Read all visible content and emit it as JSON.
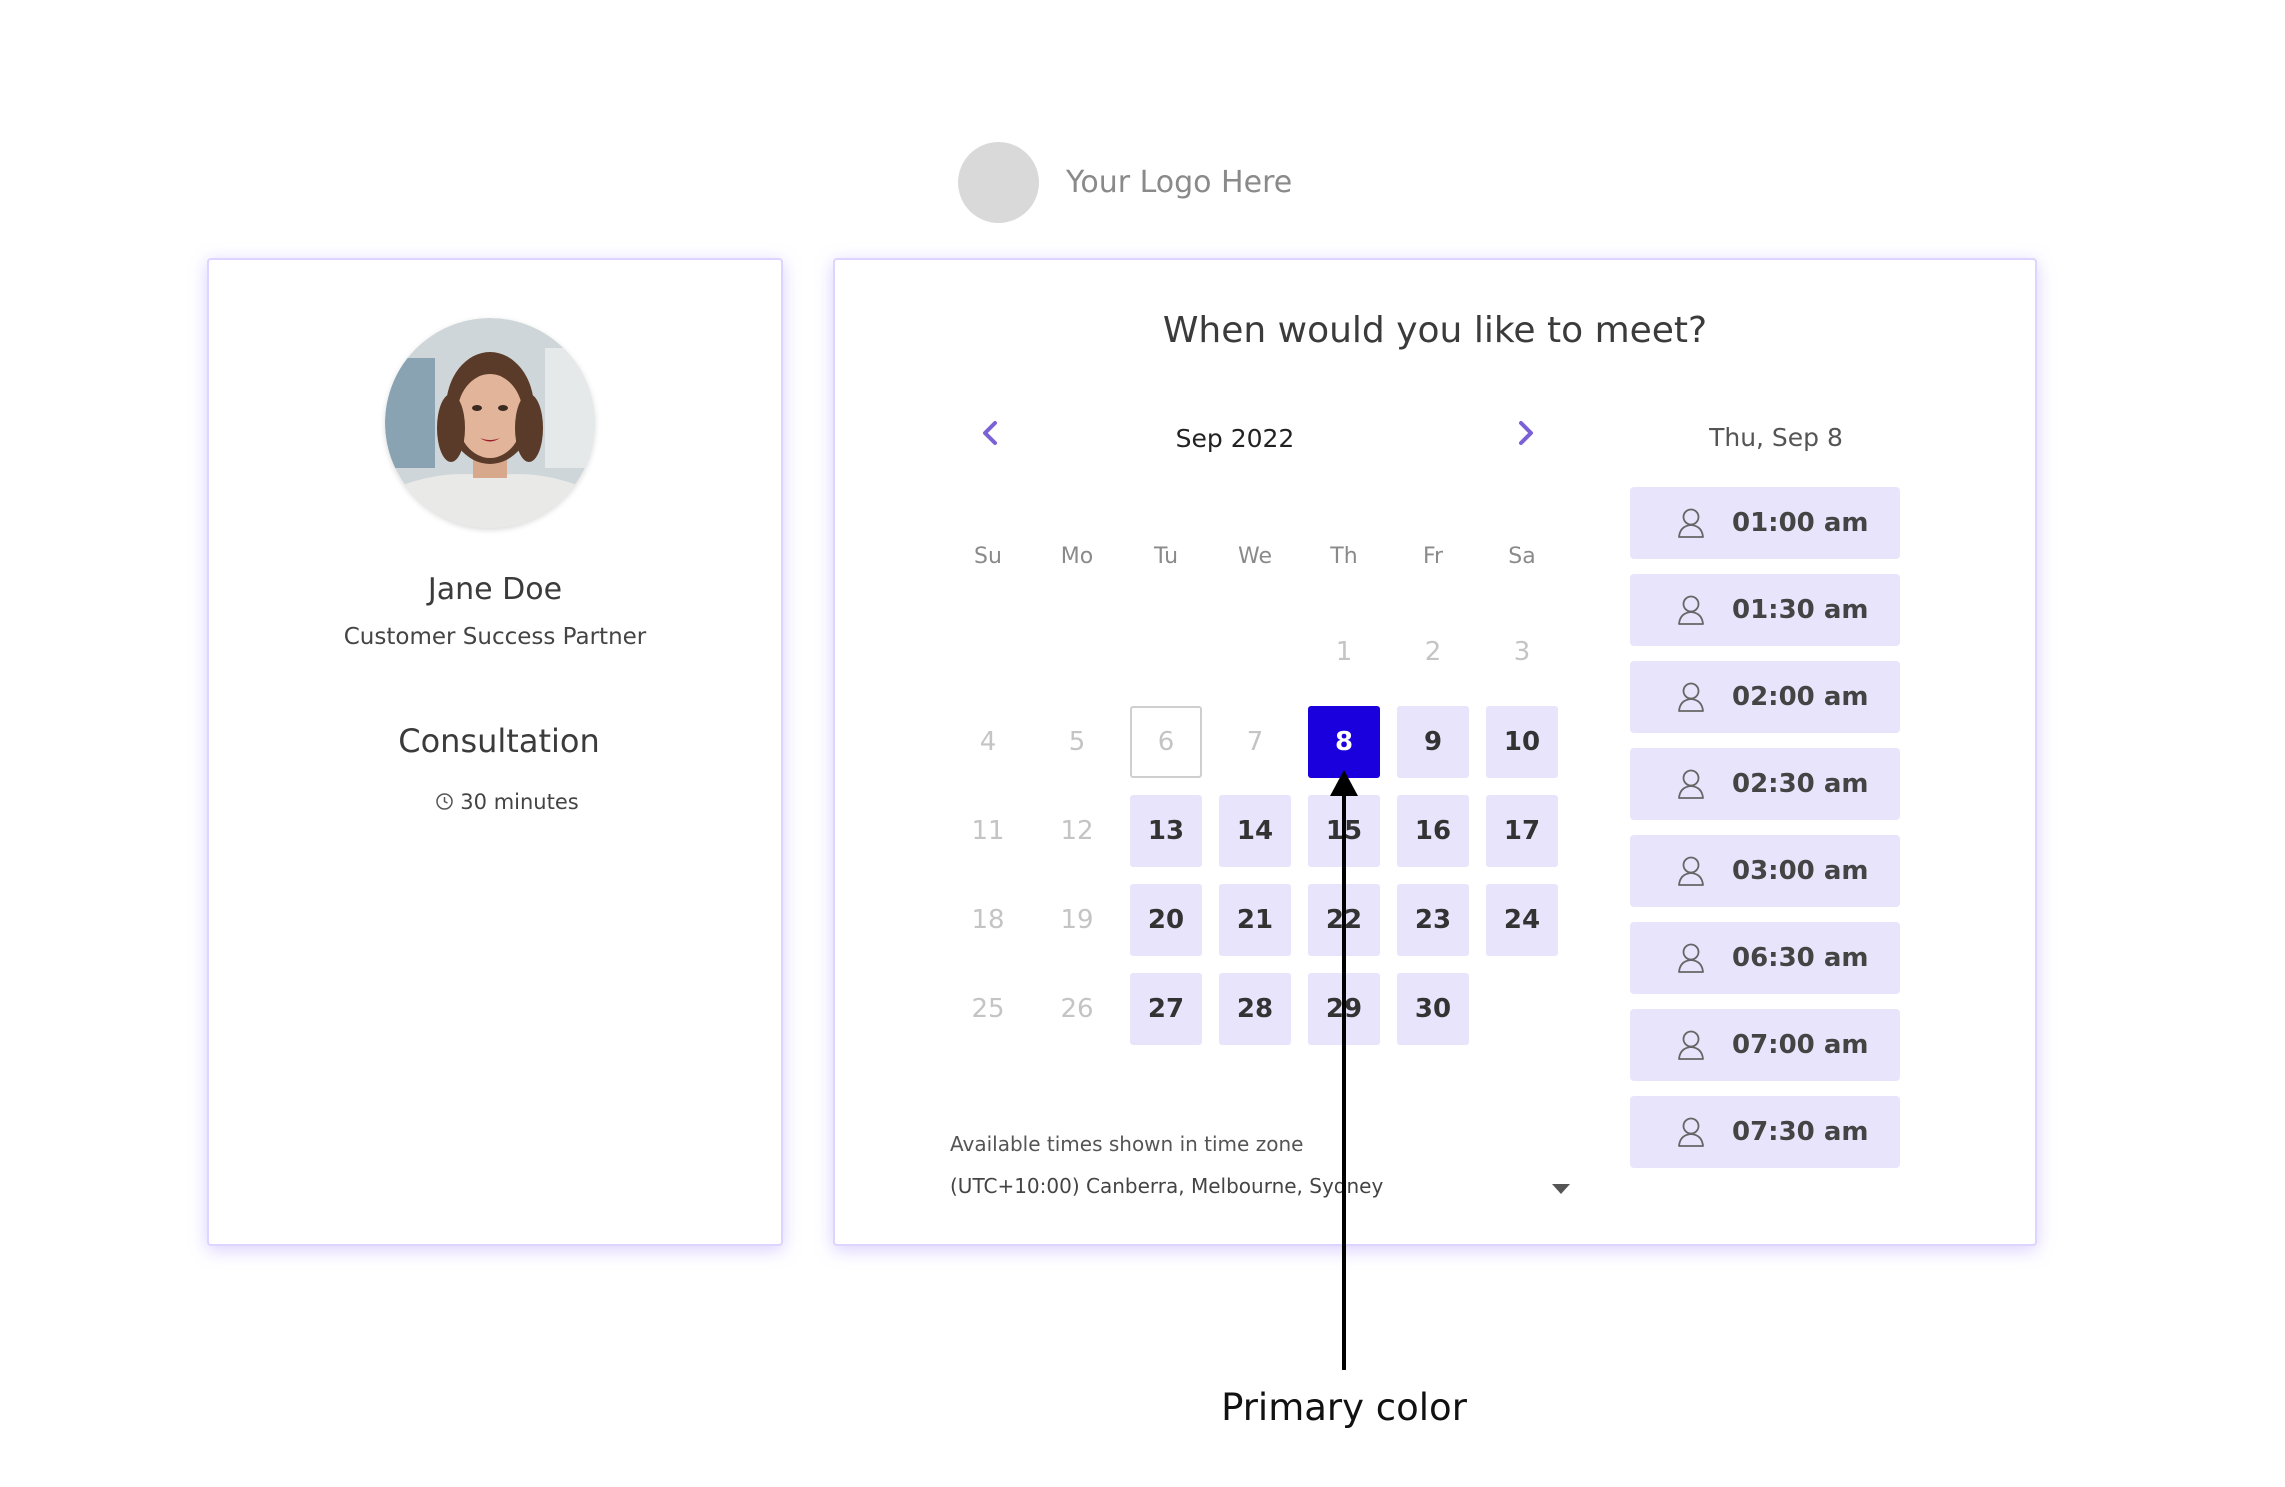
{
  "header": {
    "logo_text": "Your Logo Here"
  },
  "profile": {
    "name": "Jane Doe",
    "role": "Customer Success Partner",
    "event_title": "Consultation",
    "duration": "30 minutes",
    "duration_icon": "clock-icon"
  },
  "booking": {
    "heading": "When would you like to meet?",
    "month_label": "Sep 2022",
    "prev_icon": "chevron-left-icon",
    "next_icon": "chevron-right-icon",
    "weekdays": [
      "Su",
      "Mo",
      "Tu",
      "We",
      "Th",
      "Fr",
      "Sa"
    ],
    "weeks": [
      [
        null,
        null,
        null,
        null,
        {
          "d": "1",
          "s": "disabled"
        },
        {
          "d": "2",
          "s": "disabled"
        },
        {
          "d": "3",
          "s": "disabled"
        }
      ],
      [
        {
          "d": "4",
          "s": "disabled"
        },
        {
          "d": "5",
          "s": "disabled"
        },
        {
          "d": "6",
          "s": "today"
        },
        {
          "d": "7",
          "s": "disabled"
        },
        {
          "d": "8",
          "s": "selected"
        },
        {
          "d": "9",
          "s": "available"
        },
        {
          "d": "10",
          "s": "available"
        }
      ],
      [
        {
          "d": "11",
          "s": "disabled"
        },
        {
          "d": "12",
          "s": "disabled"
        },
        {
          "d": "13",
          "s": "available"
        },
        {
          "d": "14",
          "s": "available"
        },
        {
          "d": "15",
          "s": "available"
        },
        {
          "d": "16",
          "s": "available"
        },
        {
          "d": "17",
          "s": "available"
        }
      ],
      [
        {
          "d": "18",
          "s": "disabled"
        },
        {
          "d": "19",
          "s": "disabled"
        },
        {
          "d": "20",
          "s": "available"
        },
        {
          "d": "21",
          "s": "available"
        },
        {
          "d": "22",
          "s": "available"
        },
        {
          "d": "23",
          "s": "available"
        },
        {
          "d": "24",
          "s": "available"
        }
      ],
      [
        {
          "d": "25",
          "s": "disabled"
        },
        {
          "d": "26",
          "s": "disabled"
        },
        {
          "d": "27",
          "s": "available"
        },
        {
          "d": "28",
          "s": "available"
        },
        {
          "d": "29",
          "s": "available"
        },
        {
          "d": "30",
          "s": "available"
        },
        null
      ]
    ],
    "timezone_label": "Available times shown in time zone",
    "timezone_value": "(UTC+10:00) Canberra, Melbourne, Sydney",
    "selected_date": "Thu, Sep 8",
    "slot_icon": "person-icon",
    "slots": [
      "01:00 am",
      "01:30 am",
      "02:00 am",
      "02:30 am",
      "03:00 am",
      "06:30 am",
      "07:00 am",
      "07:30 am"
    ]
  },
  "annotation": {
    "label": "Primary color"
  },
  "colors": {
    "primary": "#1a00dd",
    "available_bg": "#e8e4fb",
    "card_border": "#ddd4ff",
    "accent_chevron": "#7b61d6"
  }
}
